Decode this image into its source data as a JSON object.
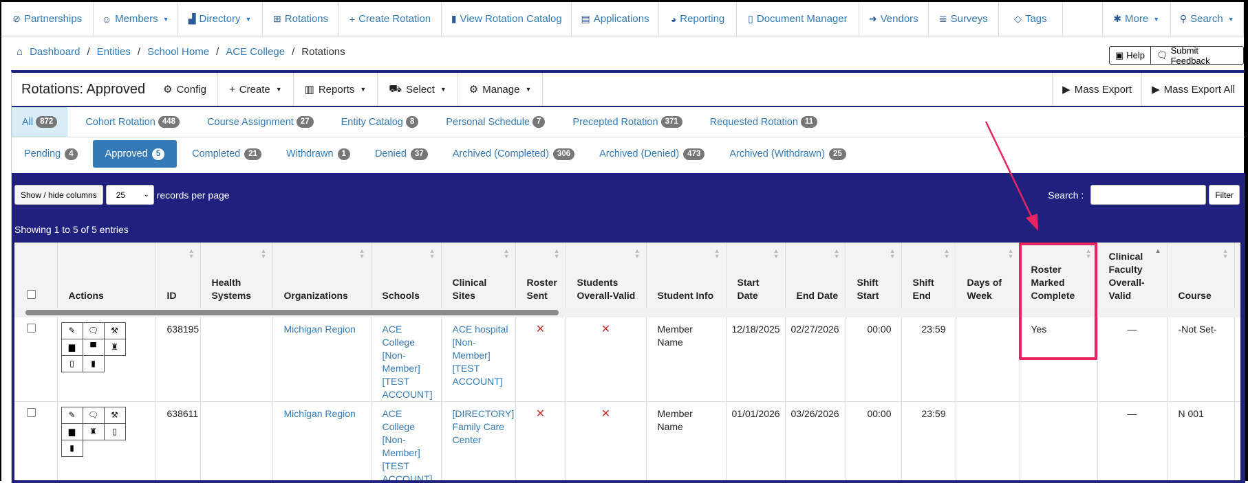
{
  "nav": [
    {
      "label": "Partnerships",
      "icon": "link-icon",
      "glyph": "⊘"
    },
    {
      "label": "Members",
      "icon": "users-icon",
      "glyph": "☺",
      "caret": true
    },
    {
      "label": "Directory",
      "icon": "building-icon",
      "glyph": "▟",
      "caret": true
    },
    {
      "label": "Rotations",
      "icon": "grid-icon",
      "glyph": "⊞"
    },
    {
      "label": "Create Rotation",
      "icon": "plus-icon",
      "glyph": "+"
    },
    {
      "label": "View Rotation Catalog",
      "icon": "book-icon",
      "glyph": "▮"
    },
    {
      "label": "Applications",
      "icon": "id-card-icon",
      "glyph": "▤"
    },
    {
      "label": "Reporting",
      "icon": "gauge-icon",
      "glyph": "◕"
    },
    {
      "label": "Document Manager",
      "icon": "file-icon",
      "glyph": "▯"
    },
    {
      "label": "Vendors",
      "icon": "sign-in-icon",
      "glyph": "➜"
    },
    {
      "label": "Surveys",
      "icon": "list-icon",
      "glyph": "≣"
    },
    {
      "label": "Tags",
      "icon": "tags-icon",
      "glyph": "◇"
    },
    {
      "label": "More",
      "icon": "gear-icon",
      "glyph": "✱",
      "caret": true
    },
    {
      "label": "Search",
      "icon": "search-icon",
      "glyph": "⚲",
      "caret": true
    }
  ],
  "breadcrumb": [
    "Dashboard",
    "Entities",
    "School Home",
    "ACE College",
    "Rotations"
  ],
  "help": {
    "help": "Help",
    "feedback": "Submit Feedback"
  },
  "header": {
    "title": "Rotations: Approved",
    "config": "Config",
    "create": "Create",
    "reports": "Reports",
    "select": "Select",
    "manage": "Manage",
    "mass_export": "Mass Export",
    "mass_export_all": "Mass Export All"
  },
  "type_tabs": [
    {
      "label": "All",
      "count": "872"
    },
    {
      "label": "Cohort Rotation",
      "count": "448"
    },
    {
      "label": "Course Assignment",
      "count": "27"
    },
    {
      "label": "Entity Catalog",
      "count": "8"
    },
    {
      "label": "Personal Schedule",
      "count": "7"
    },
    {
      "label": "Precepted Rotation",
      "count": "371"
    },
    {
      "label": "Requested Rotation",
      "count": "11"
    }
  ],
  "status_tabs": [
    {
      "label": "Pending",
      "count": "4"
    },
    {
      "label": "Approved",
      "count": "5"
    },
    {
      "label": "Completed",
      "count": "21"
    },
    {
      "label": "Withdrawn",
      "count": "1"
    },
    {
      "label": "Denied",
      "count": "37"
    },
    {
      "label": "Archived (Completed)",
      "count": "306"
    },
    {
      "label": "Archived (Denied)",
      "count": "473"
    },
    {
      "label": "Archived (Withdrawn)",
      "count": "25"
    }
  ],
  "controls": {
    "show_hide": "Show / hide columns",
    "per_page": "25",
    "per_page_label": "records per page",
    "search_label": "Search :",
    "filter": "Filter",
    "showing": "Showing 1 to 5 of 5 entries"
  },
  "columns": [
    "Actions",
    "ID",
    "Health Systems",
    "Organizations",
    "Schools",
    "Clinical Sites",
    "Roster Sent",
    "Students Overall-Valid",
    "Student Info",
    "Start Date",
    "End Date",
    "Shift Start",
    "Shift End",
    "Days of Week",
    "Roster Marked Complete",
    "Clinical Faculty Overall-Valid",
    "Course"
  ],
  "rows": [
    {
      "id": "638195",
      "health": "",
      "org": "Michigan Region",
      "school": "ACE College [Non-Member] [TEST ACCOUNT]",
      "site": "ACE hospital [Non-Member] [TEST ACCOUNT]",
      "roster_sent": "✕",
      "students_valid": "✕",
      "student_info": "Member Name",
      "start": "12/18/2025",
      "end": "02/27/2026",
      "shift_start": "00:00",
      "shift_end": "23:59",
      "days": "",
      "roster_marked": "Yes",
      "faculty_valid": "—",
      "course": "-Not Set-",
      "actions": [
        [
          "edit-icon",
          "✎"
        ],
        [
          "comment-icon",
          "🗨"
        ],
        [
          "gavel-icon",
          "⚒"
        ],
        [
          "file-excel-icon",
          "▆"
        ],
        [
          "teacher-icon",
          "▀"
        ],
        [
          "graduate-icon",
          "♜"
        ],
        [
          "file-icon",
          "▯"
        ],
        [
          "clipboard-icon",
          "▮"
        ]
      ]
    },
    {
      "id": "638611",
      "health": "",
      "org": "Michigan Region",
      "school": "ACE College [Non-Member] [TEST ACCOUNT]",
      "site": "[DIRECTORY] Family Care Center",
      "roster_sent": "✕",
      "students_valid": "✕",
      "student_info": "Member Name",
      "start": "01/01/2026",
      "end": "03/26/2026",
      "shift_start": "00:00",
      "shift_end": "23:59",
      "days": "",
      "roster_marked": "",
      "faculty_valid": "—",
      "course": "N 001",
      "actions": [
        [
          "edit-icon",
          "✎"
        ],
        [
          "comment-icon",
          "🗨"
        ],
        [
          "gavel-icon",
          "⚒"
        ],
        [
          "file-excel-icon",
          "▆"
        ],
        [
          "graduate-icon",
          "♜"
        ],
        [
          "file-icon",
          "▯"
        ],
        [
          "clipboard-icon",
          "▮"
        ]
      ]
    }
  ],
  "colors": {
    "navy": "#20217f",
    "link": "#337ab7",
    "highlight": "#e8245f",
    "badge": "#777777"
  }
}
